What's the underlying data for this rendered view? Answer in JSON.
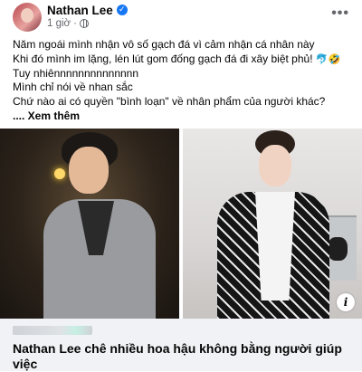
{
  "post": {
    "author": "Nathan Lee",
    "time": "1 giờ",
    "lines": [
      "Năm ngoái mình nhận vô số gạch đá vì cảm nhận cá nhân này",
      "Khi đó mình im lặng, lén lút gom đống gạch đá đi xây biệt phủ!",
      "Tuy nhiênnnnnnnnnnnnnn",
      "Mình chỉ nói về nhan sắc",
      "Chứ nào ai có quyền \"bình loạn\" về nhân phẩm của người khác?"
    ],
    "see_more": ".... Xem thêm"
  },
  "link": {
    "headline": "Nathan Lee chê nhiều hoa hậu không bằng người giúp việc"
  },
  "icons": {
    "verified": "✓",
    "more": "•••",
    "info": "i",
    "emoji_1": "🐬",
    "emoji_2": "🤣"
  }
}
